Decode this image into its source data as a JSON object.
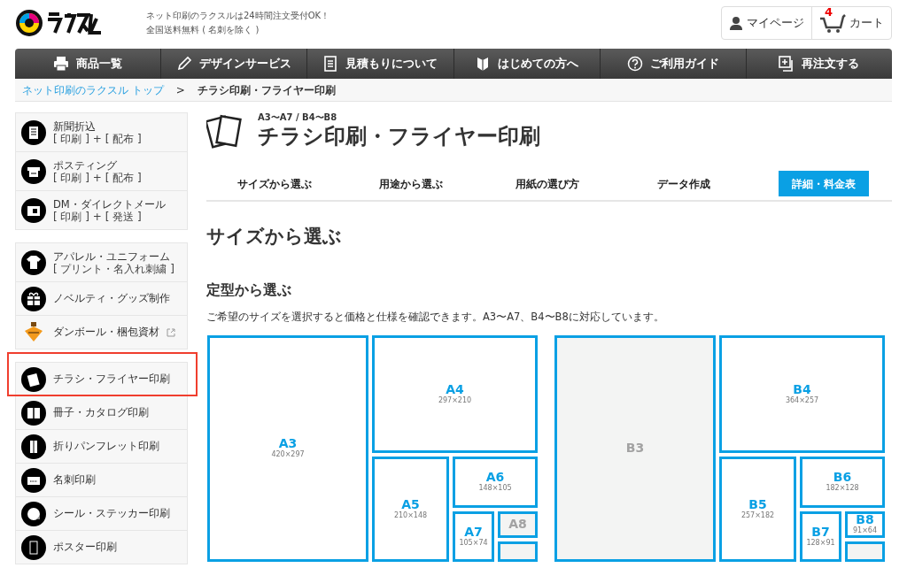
{
  "header": {
    "tagline": [
      "ネット印刷のラクスルは24時間注文受付OK！",
      "全国送料無料 ( 名刺を除く )"
    ],
    "mypage": "マイページ",
    "cart": {
      "label": "カート",
      "count": "4"
    }
  },
  "nav": [
    "商品一覧",
    "デザインサービス",
    "見積もりについて",
    "はじめての方へ",
    "ご利用ガイド",
    "再注文する"
  ],
  "breadcrumb": {
    "link": "ネット印刷のラクスル トップ",
    "separator": ">",
    "current": "チラシ印刷・フライヤー印刷"
  },
  "sidebar": [
    [
      {
        "title": "新聞折込",
        "sub": "[ 印刷 ] + [ 配布 ]",
        "external": false,
        "highlighted": false
      },
      {
        "title": "ポスティング",
        "sub": "[ 印刷 ] + [ 配布 ]",
        "external": false,
        "highlighted": false
      },
      {
        "title": "DM・ダイレクトメール",
        "sub": "[ 印刷 ] + [ 発送 ]",
        "external": false,
        "highlighted": false
      }
    ],
    [
      {
        "title": "アパレル・ユニフォーム",
        "sub": "[ プリント・名入れ刺繍 ]",
        "external": false,
        "highlighted": false
      },
      {
        "title": "ノベルティ・グッズ制作",
        "external": false,
        "highlighted": false
      },
      {
        "title": "ダンボール・梱包資材",
        "external": true,
        "highlighted": false
      }
    ],
    [
      {
        "title": "チラシ・フライヤー印刷",
        "external": false,
        "highlighted": true
      },
      {
        "title": "冊子・カタログ印刷",
        "external": false,
        "highlighted": false
      },
      {
        "title": "折りパンフレット印刷",
        "external": false,
        "highlighted": false
      },
      {
        "title": "名刺印刷",
        "external": false,
        "highlighted": false
      },
      {
        "title": "シール・ステッカー印刷",
        "external": false,
        "highlighted": false
      },
      {
        "title": "ポスター印刷",
        "external": false,
        "highlighted": false
      }
    ]
  ],
  "product": {
    "sizes": "A3〜A7 / B4〜B8",
    "title": "チラシ印刷・フライヤー印刷"
  },
  "tabs": [
    {
      "label": "サイズから選ぶ",
      "selected": false
    },
    {
      "label": "用途から選ぶ",
      "selected": false
    },
    {
      "label": "用紙の選び方",
      "selected": false
    },
    {
      "label": "データ作成",
      "selected": false
    },
    {
      "label": "詳細・料金表",
      "selected": true
    }
  ],
  "section_title": "サイズから選ぶ",
  "subsection_title": "定型から選ぶ",
  "description": "ご希望のサイズを選択すると価格と仕様を確認できます。A3〜A7、B4〜B8に対応しています。",
  "paper_sizes": [
    {
      "kind": "size",
      "label": "A3",
      "dims": "420×297",
      "available": true
    },
    {
      "kind": "size",
      "label": "A4",
      "dims": "297×210",
      "available": true
    },
    {
      "kind": "size",
      "label": "A5",
      "dims": "210×148",
      "available": true
    },
    {
      "kind": "size",
      "label": "A6",
      "dims": "148×105",
      "available": true
    },
    {
      "kind": "size",
      "label": "A7",
      "dims": "105×74",
      "available": true
    },
    {
      "kind": "size",
      "label": "A8",
      "available": false
    },
    {
      "kind": "blank",
      "available": false
    },
    {
      "kind": "size",
      "label": "B3",
      "available": false
    },
    {
      "kind": "size",
      "label": "B4",
      "dims": "364×257",
      "available": true
    },
    {
      "kind": "size",
      "label": "B5",
      "dims": "257×182",
      "available": true
    },
    {
      "kind": "size",
      "label": "B6",
      "dims": "182×128",
      "available": true
    },
    {
      "kind": "size",
      "label": "B7",
      "dims": "128×91",
      "available": true
    },
    {
      "kind": "size",
      "label": "B8",
      "dims": "91×64",
      "available": true
    },
    {
      "kind": "blank",
      "available": false
    }
  ]
}
